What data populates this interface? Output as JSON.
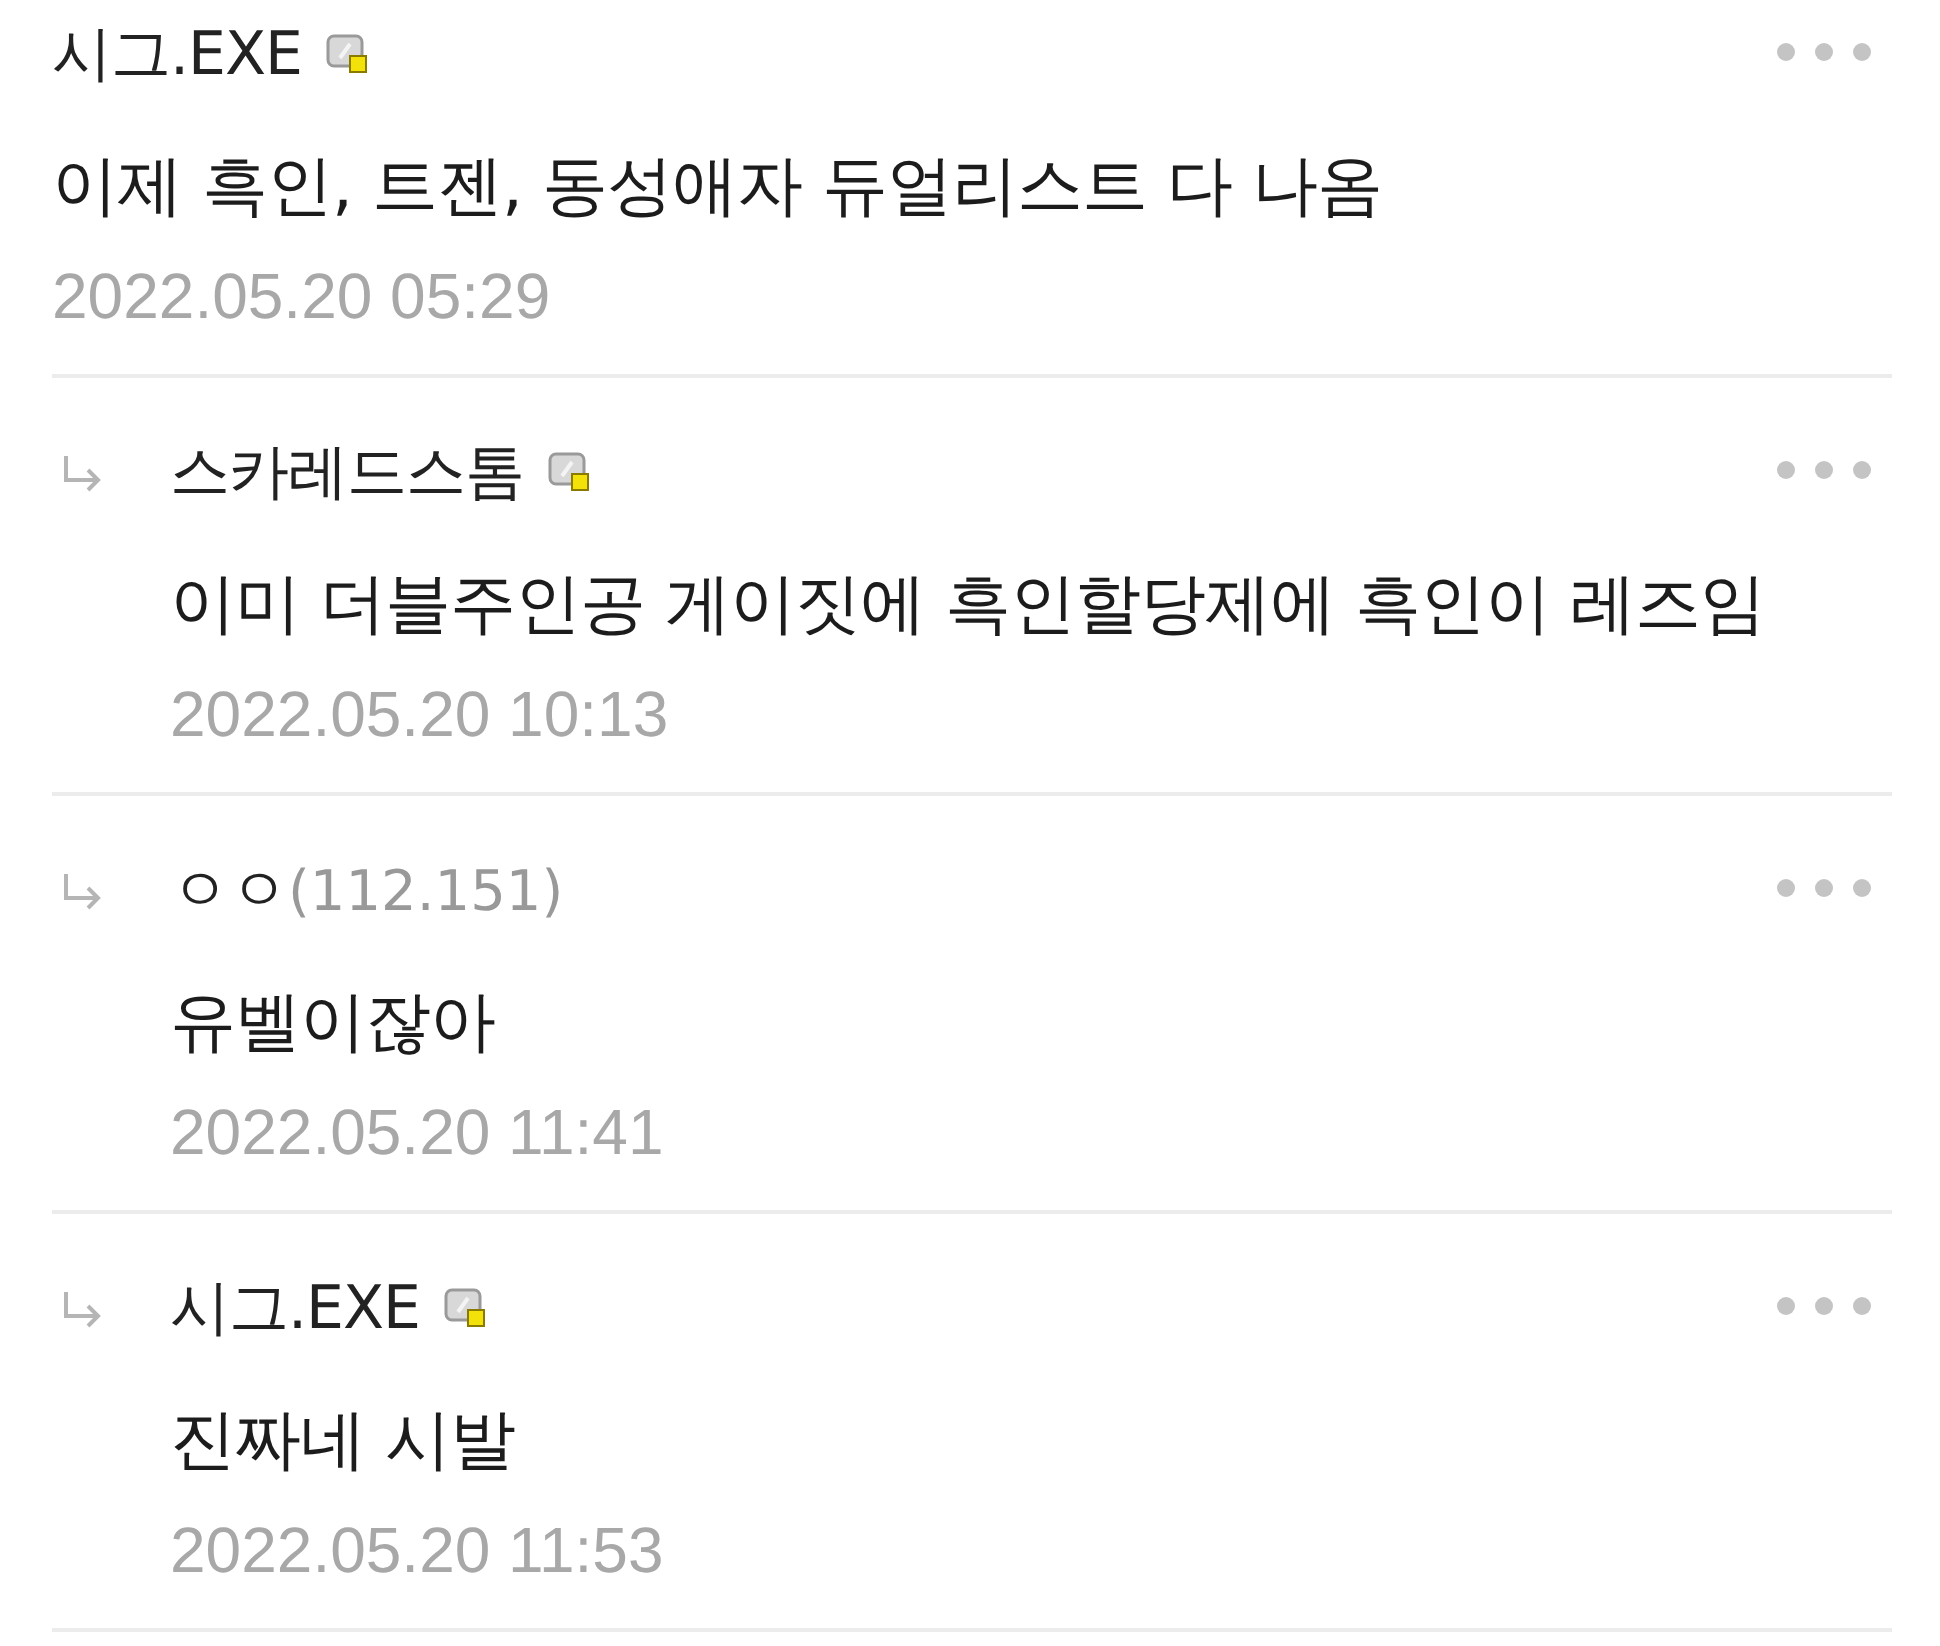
{
  "comments": [
    {
      "kind": "comment",
      "author": "시그.EXE",
      "fixed_nick": true,
      "text": "이제 흑인, 트젠, 동성애자 듀얼리스트 다 나옴",
      "date": "2022.05.20 05:29"
    },
    {
      "kind": "reply",
      "author": "스카레드스톰",
      "fixed_nick": true,
      "text": "이미 더블주인공 게이짓에 흑인할당제에 흑인이 레즈임",
      "date": "2022.05.20 10:13"
    },
    {
      "kind": "reply",
      "author": "ㅇㅇ",
      "ip": "(112.151)",
      "fixed_nick": false,
      "text": "유벨이잖아",
      "date": "2022.05.20 11:41"
    },
    {
      "kind": "reply",
      "author": "시그.EXE",
      "fixed_nick": true,
      "text": "진짜네 시발",
      "date": "2022.05.20 11:53"
    }
  ]
}
